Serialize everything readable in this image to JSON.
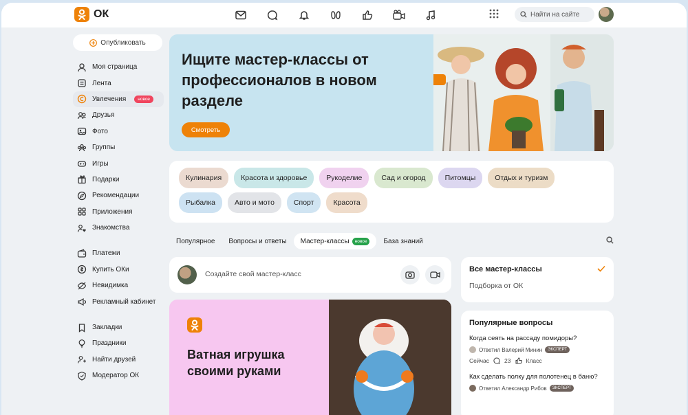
{
  "brand": {
    "name": "ОК",
    "accent": "#ee8208"
  },
  "header": {
    "nav_icons": [
      "mail-icon",
      "chat-icon",
      "bell-icon",
      "guests-icon",
      "like-icon",
      "video-icon",
      "music-icon"
    ],
    "search_placeholder": "Найти на сайте"
  },
  "sidebar": {
    "publish_label": "Опубликовать",
    "group1": [
      {
        "label": "Моя страница",
        "icon": "user-icon"
      },
      {
        "label": "Лента",
        "icon": "feed-icon"
      },
      {
        "label": "Увлечения",
        "icon": "hobby-icon",
        "badge": "новое",
        "active": true
      },
      {
        "label": "Друзья",
        "icon": "friends-icon"
      },
      {
        "label": "Фото",
        "icon": "photo-icon"
      },
      {
        "label": "Группы",
        "icon": "groups-icon"
      },
      {
        "label": "Игры",
        "icon": "games-icon"
      },
      {
        "label": "Подарки",
        "icon": "gift-icon"
      },
      {
        "label": "Рекомендации",
        "icon": "compass-icon"
      },
      {
        "label": "Приложения",
        "icon": "apps-icon"
      },
      {
        "label": "Знакомства",
        "icon": "dating-icon"
      }
    ],
    "group2": [
      {
        "label": "Платежи",
        "icon": "wallet-icon"
      },
      {
        "label": "Купить ОКи",
        "icon": "coin-icon"
      },
      {
        "label": "Невидимка",
        "icon": "invisible-icon"
      },
      {
        "label": "Рекламный кабинет",
        "icon": "ads-icon"
      }
    ],
    "group3": [
      {
        "label": "Закладки",
        "icon": "bookmark-icon"
      },
      {
        "label": "Праздники",
        "icon": "holiday-icon"
      },
      {
        "label": "Найти друзей",
        "icon": "find-friends-icon"
      },
      {
        "label": "Модератор ОК",
        "icon": "moderator-icon"
      }
    ]
  },
  "banner": {
    "title": "Ищите мастер-классы от профессионалов в новом разделе",
    "button": "Смотреть"
  },
  "categories": [
    {
      "label": "Кулинария",
      "color": "#ebdad0"
    },
    {
      "label": "Красота и здоровье",
      "color": "#c9e7e8"
    },
    {
      "label": "Рукоделие",
      "color": "#f0d2ef"
    },
    {
      "label": "Сад и огород",
      "color": "#d9e8cf"
    },
    {
      "label": "Питомцы",
      "color": "#dcd7f0"
    },
    {
      "label": "Отдых и туризм",
      "color": "#ecdcc6"
    },
    {
      "label": "Рыбалка",
      "color": "#cde2f2"
    },
    {
      "label": "Авто и мото",
      "color": "#e2e4e8"
    },
    {
      "label": "Спорт",
      "color": "#d0e4f2"
    },
    {
      "label": "Красота",
      "color": "#efdccb"
    }
  ],
  "tabs": [
    {
      "label": "Популярное"
    },
    {
      "label": "Вопросы и ответы"
    },
    {
      "label": "Мастер-классы",
      "badge": "новое",
      "active": true
    },
    {
      "label": "База знаний"
    }
  ],
  "create": {
    "placeholder": "Создайте свой мастер-класс"
  },
  "card": {
    "title": "Ватная игрушка своими руками"
  },
  "all_mc": {
    "title": "Все мастер-классы",
    "subtitle": "Подборка от ОК"
  },
  "popular": {
    "title": "Популярные вопросы",
    "items": [
      {
        "question": "Когда сеять на рассаду помидоры?",
        "answered_by": "Ответил Валерий Минин",
        "badge": "ЭКСПЕРТ",
        "time": "Сейчас",
        "comments": "23",
        "class": "Класс"
      },
      {
        "question": "Как сделать полку для полотенец в баню?",
        "answered_by": "Ответил Александр Рибов",
        "badge": "ЭКСПЕРТ"
      }
    ]
  }
}
